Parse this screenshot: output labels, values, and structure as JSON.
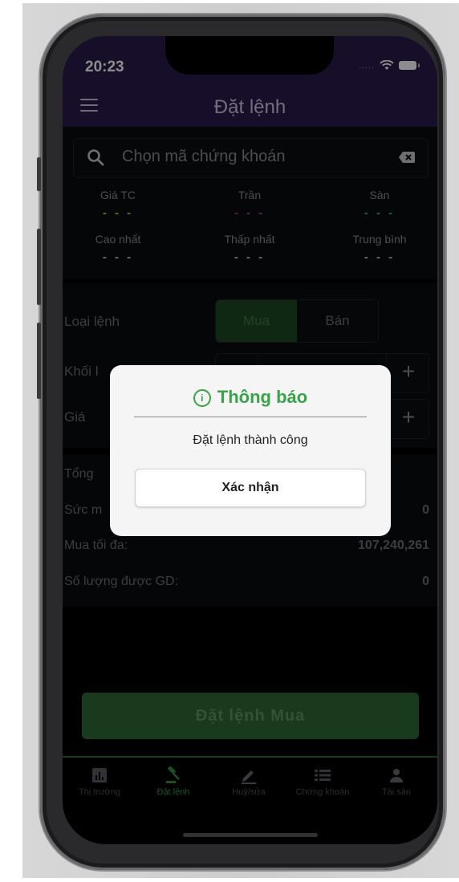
{
  "status_bar": {
    "time": "20:23",
    "dots": "....."
  },
  "header": {
    "title": "Đặt lệnh"
  },
  "search": {
    "placeholder": "Chọn mã chứng khoán"
  },
  "quote": {
    "ref": {
      "label": "Giá TC",
      "value": "- - -",
      "color": "#c8c24a"
    },
    "ceil": {
      "label": "Trần",
      "value": "- - -",
      "color": "#b23aa8"
    },
    "floor": {
      "label": "Sàn",
      "value": "- - -",
      "color": "#36a88f"
    },
    "high": {
      "label": "Cao nhất",
      "value": "- - -",
      "color": "#c9c9cc"
    },
    "low": {
      "label": "Thấp nhất",
      "value": "- - -",
      "color": "#c9c9cc"
    },
    "avg": {
      "label": "Trung bình",
      "value": "- - -",
      "color": "#c9c9cc"
    }
  },
  "form": {
    "order_type_label": "Loại lệnh",
    "buy_label": "Mua",
    "sell_label": "Bán",
    "volume_label": "Khối l",
    "price_label": "Giá",
    "plus": "+"
  },
  "summary": {
    "total_label": "Tổng",
    "power_label": "Sức m",
    "power_value": "0",
    "max_buy_label": "Mua tối đa:",
    "max_buy_value": "107,240,261",
    "tradable_label": "Số lượng được GD:",
    "tradable_value": "0"
  },
  "order_button": "Đặt lệnh Mua",
  "tabs": [
    {
      "label": "Thị trường",
      "icon": "chart-icon"
    },
    {
      "label": "Đặt lệnh",
      "icon": "gavel-icon"
    },
    {
      "label": "Huỷ/sửa",
      "icon": "pencil-icon"
    },
    {
      "label": "Chứng khoán",
      "icon": "list-icon"
    },
    {
      "label": "Tài sản",
      "icon": "person-icon"
    }
  ],
  "dialog": {
    "title": "Thông báo",
    "message": "Đặt lệnh thành công",
    "confirm": "Xác nhận"
  },
  "colors": {
    "header_bg": "#2a1c4b",
    "accent_green": "#3aa34a",
    "active_tab": "#3a8f46"
  }
}
